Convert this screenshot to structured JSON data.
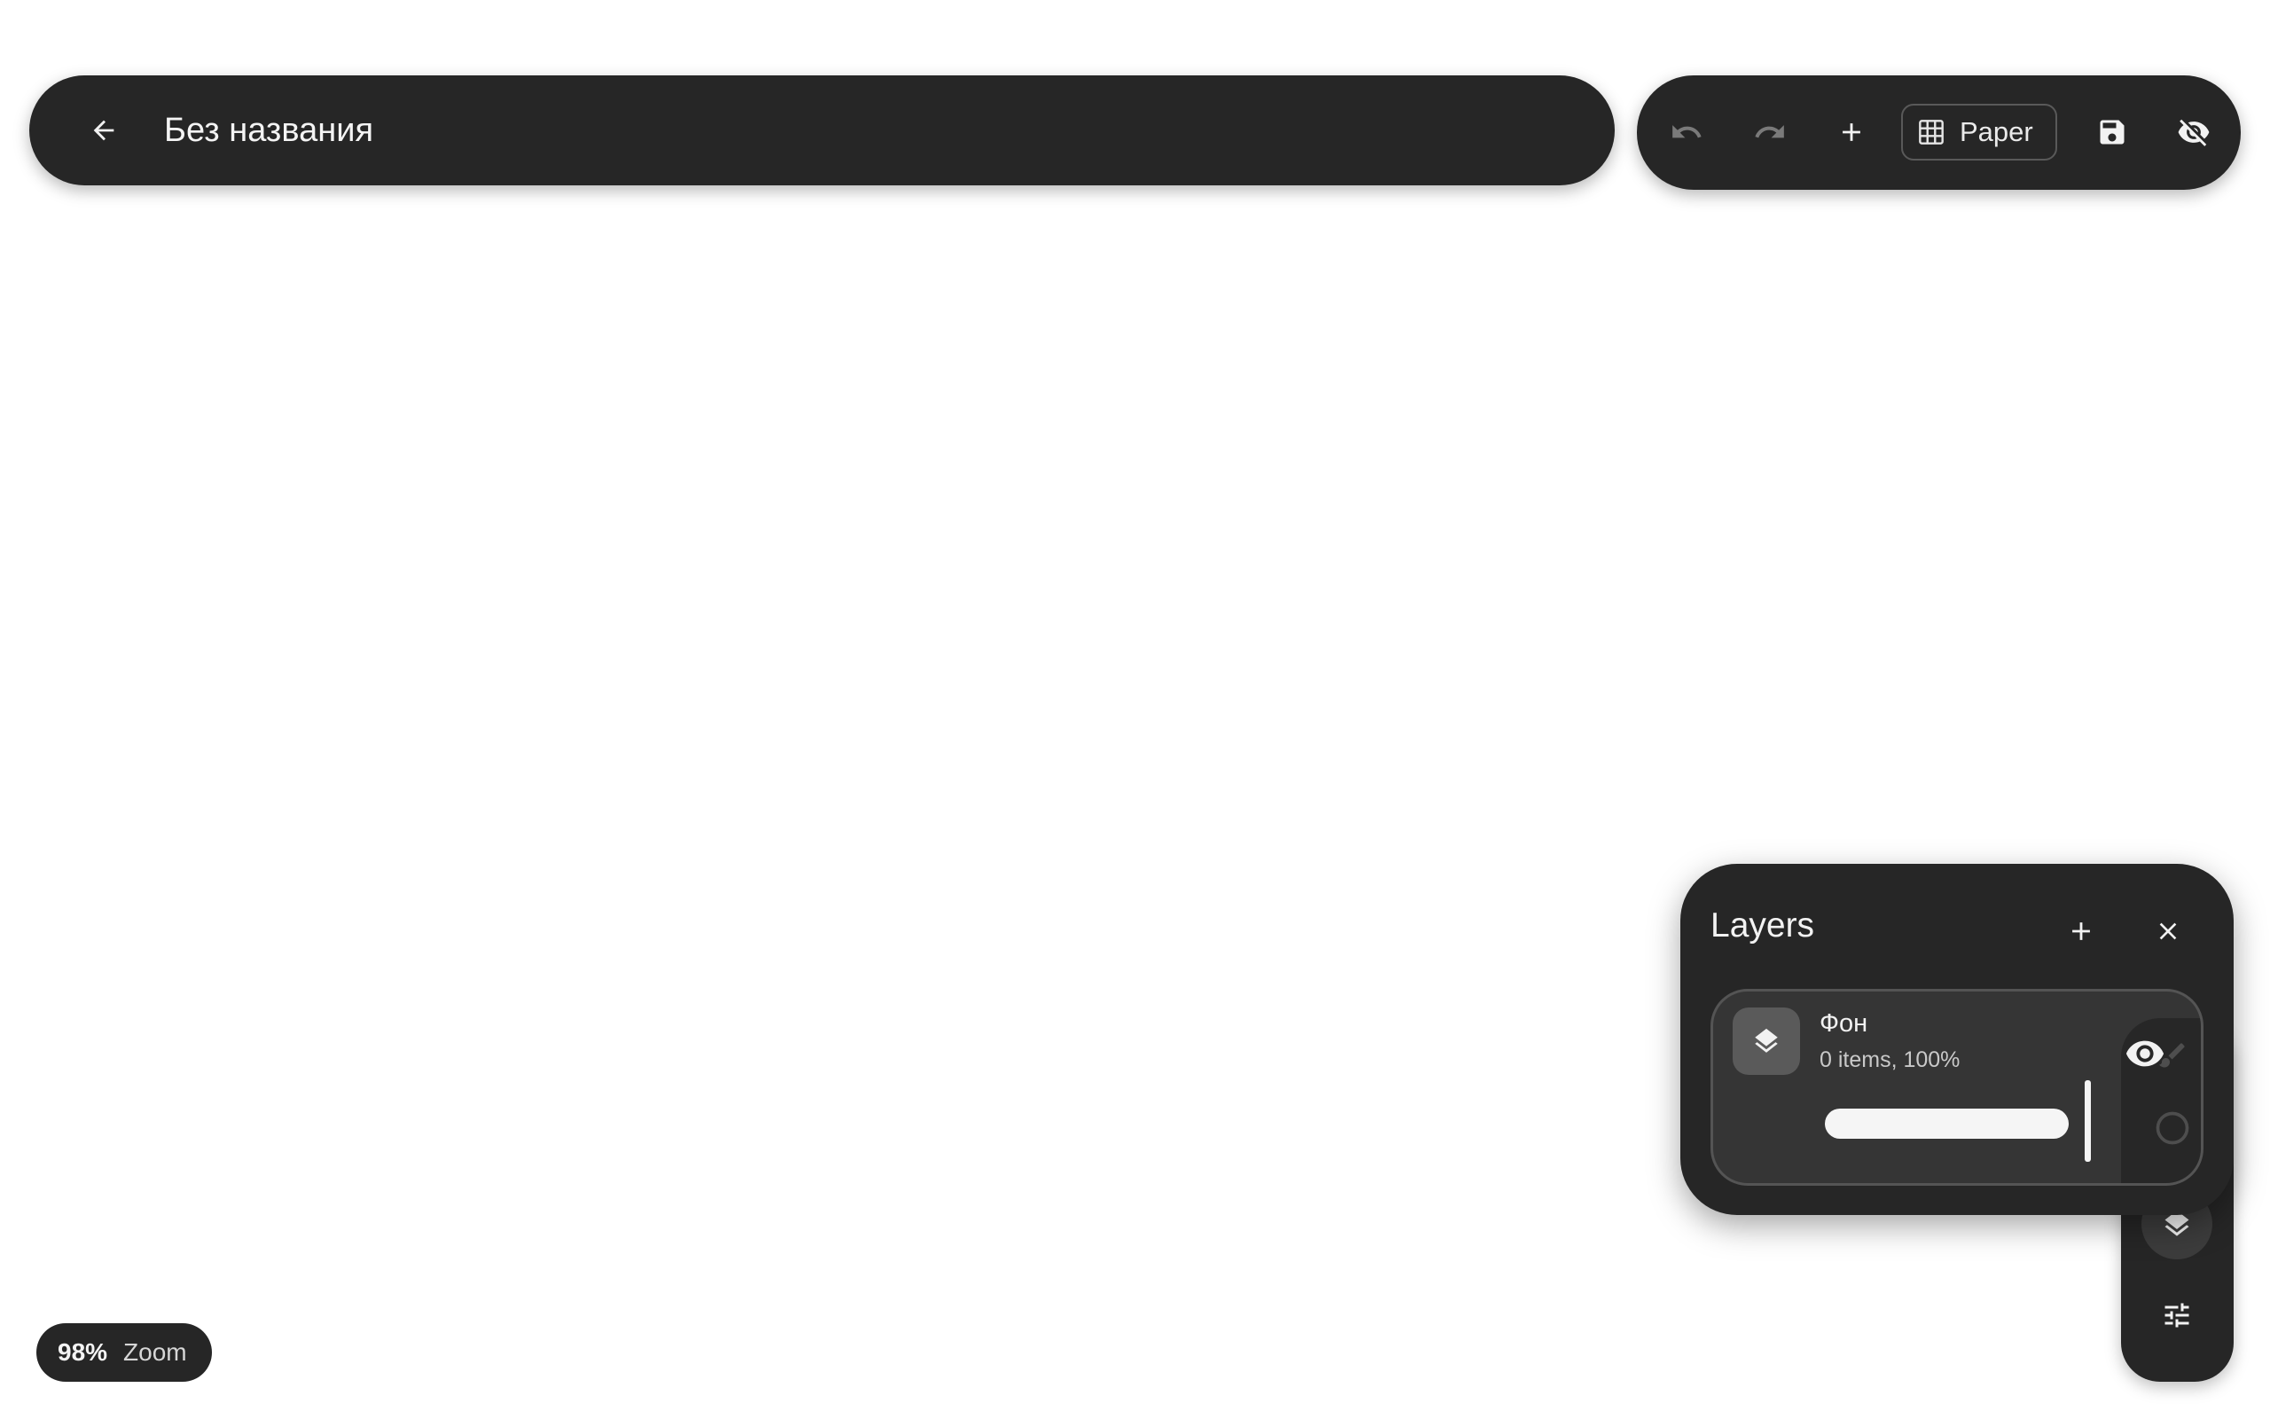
{
  "header": {
    "document_title": "Без названия"
  },
  "toolbar": {
    "paper_label": "Paper"
  },
  "layers_panel": {
    "title": "Layers",
    "layers": [
      {
        "name": "Фон",
        "meta": "0 items, 100%",
        "visible": true,
        "opacity_percent": 100
      }
    ]
  },
  "zoom": {
    "value": "98%",
    "label": "Zoom"
  },
  "icons": {
    "back": "arrow-left-icon",
    "undo": "undo-icon",
    "redo": "redo-icon",
    "add": "plus-icon",
    "paper_grid": "grid-icon",
    "save": "floppy-disk-icon",
    "hide_ui": "eye-off-icon",
    "layers": "layers-icon",
    "visibility": "eye-icon",
    "close": "close-icon",
    "brush": "brush-icon",
    "color": "circle-icon",
    "settings": "sliders-icon"
  },
  "colors": {
    "canvas_background": "#ffffff",
    "surface": "#262626",
    "card_surface": "#353535",
    "text_primary": "#f2f2f2",
    "disabled_icon": "#7a7a7a"
  }
}
